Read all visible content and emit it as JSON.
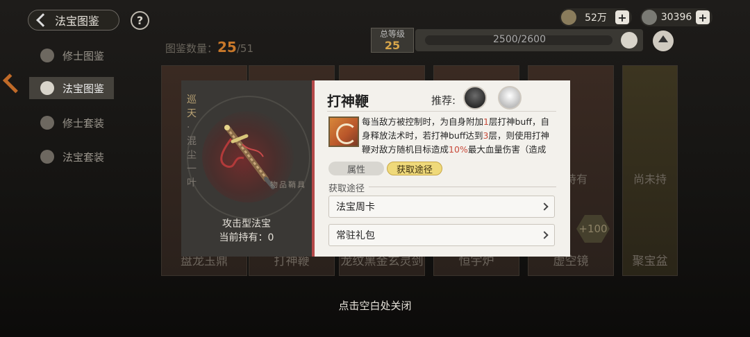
{
  "header": {
    "back_label": "法宝图鉴",
    "help_label": "?",
    "currency": [
      {
        "icon": "coin-icon",
        "value": "52万",
        "plus": "+"
      },
      {
        "icon": "spirit-stone-icon",
        "value": "30396",
        "plus": "+"
      }
    ],
    "level_label": "总等级",
    "level_value": "25",
    "exp_text": "2500/2600"
  },
  "collection": {
    "label": "图鉴数量：",
    "count": "25",
    "total": "/51"
  },
  "sidebar": {
    "items": [
      {
        "label": "修士图鉴"
      },
      {
        "label": "法宝图鉴"
      },
      {
        "label": "修士套装"
      },
      {
        "label": "法宝套装"
      }
    ]
  },
  "cards": [
    {
      "name": "盘龙玉鼎",
      "mid": "尚"
    },
    {
      "name": "打神鞭",
      "mid": ""
    },
    {
      "name": "龙纹黑金玄灵剑",
      "mid": ""
    },
    {
      "name": "恒宇炉",
      "mid": ""
    },
    {
      "name": "虚空镜",
      "mid": "未持有"
    },
    {
      "name": "聚宝盆",
      "mid": "尚未持"
    }
  ],
  "plus_badge": "+100",
  "detail": {
    "deco_text": [
      "巡",
      "天",
      "·",
      "混",
      "尘",
      "一",
      "叶"
    ],
    "stamp": "物品鞘具",
    "type": "攻击型法宝",
    "hold": "当前持有：0",
    "title": "打神鞭",
    "recommend_label": "推荐:",
    "desc": {
      "p1": "每当敌方被控制时，为自身附加",
      "n1": "1",
      "p2": "层打神buff，自身释放法术时，若打神buff达到",
      "n2": "3",
      "p3": "层，则使用打神鞭对敌方随机目标造成",
      "n3": "10%",
      "p4": "最大血量伤害（造成"
    },
    "tabs": [
      "属性",
      "获取途径"
    ],
    "section_label": "获取途径",
    "sources": [
      "法宝周卡",
      "常驻礼包"
    ]
  },
  "close_hint": "点击空白处关闭",
  "colors": {
    "accent": "#b44848",
    "highlight_tab": "#efd97a",
    "level_gold": "#d7a54a",
    "collection_orange": "#c8782a",
    "emph_red": "#c84a3a"
  }
}
